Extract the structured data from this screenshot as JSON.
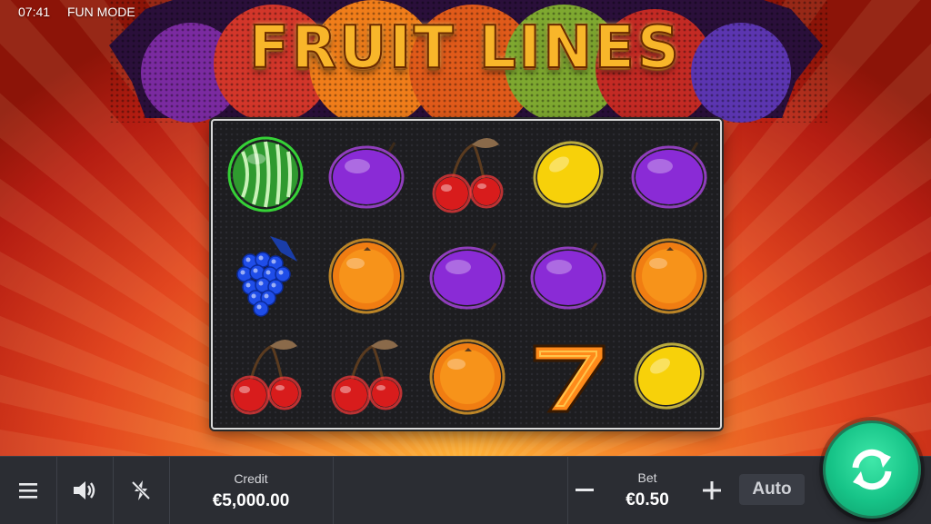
{
  "status_bar": {
    "time": "07:41",
    "mode": "FUN MODE"
  },
  "game": {
    "title": "FRUIT LINES",
    "reels": [
      [
        "watermelon",
        "grapes",
        "cherries"
      ],
      [
        "plum",
        "orange",
        "cherries"
      ],
      [
        "cherries",
        "plum",
        "orange"
      ],
      [
        "lemon",
        "plum",
        "seven"
      ],
      [
        "plum",
        "orange",
        "lemon"
      ]
    ]
  },
  "bottom_bar": {
    "menu_icon": "hamburger-menu-icon",
    "sound_icon": "speaker-icon",
    "turbo_icon": "lightning-off-icon",
    "credit_label": "Credit",
    "credit_value": "€5,000.00",
    "bet_label": "Bet",
    "bet_value": "€0.50",
    "bet_decrease": "−",
    "bet_increase": "+",
    "auto_label": "Auto",
    "spin_icon": "spin-arrows-icon"
  },
  "colors": {
    "spin_button": "#17c488",
    "bar_background": "#2b2d33",
    "reel_background": "#1d1d20",
    "title_gold": "#f8b62a"
  }
}
